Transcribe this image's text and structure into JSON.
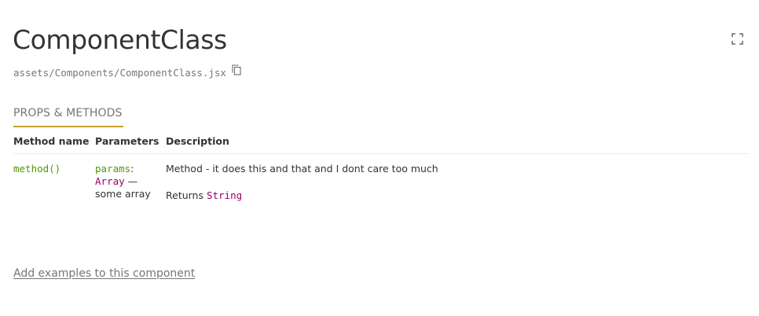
{
  "component": {
    "name": "ComponentClass",
    "path": "assets/Components/ComponentClass.jsx"
  },
  "icons": {
    "fullscreen": "fullscreen-icon",
    "copy": "copy-icon"
  },
  "tab": {
    "label": "PROPS & METHODS"
  },
  "methods_table": {
    "headers": [
      "Method name",
      "Parameters",
      "Description"
    ],
    "rows": [
      {
        "name": "method()",
        "param_name": "params",
        "param_colon": ":",
        "param_type": "Array",
        "param_dash": " —",
        "param_desc": "some array",
        "description": "Method - it does this and that and I dont care too much",
        "returns_label": "Returns ",
        "returns_type": "String"
      }
    ]
  },
  "add_examples_link": "Add examples to this component",
  "colors": {
    "accent": "#c5a12c",
    "name_green": "#4f9a00",
    "type_purple": "#970065",
    "muted_text": "#767676",
    "text": "#333333"
  }
}
